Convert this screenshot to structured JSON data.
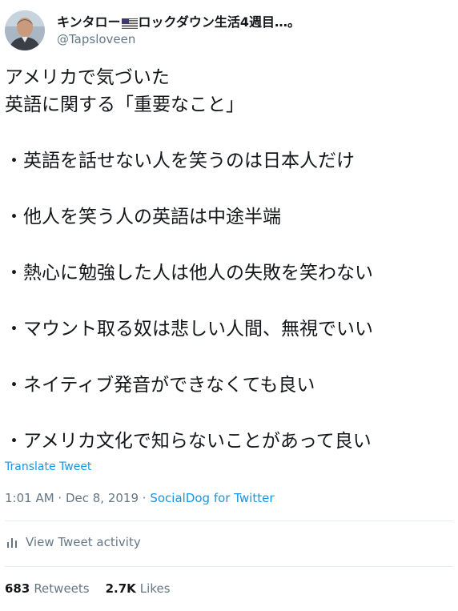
{
  "user": {
    "display_name_pre": "キンタロー",
    "display_name_post": "ロックダウン生活4週目…。",
    "handle": "@Tapsloveen",
    "flag_icon": "us-flag-icon"
  },
  "tweet": {
    "lines": [
      "アメリカで気づいた",
      "英語に関する「重要なこと」"
    ],
    "bullets": [
      "・英語を話せない人を笑うのは日本人だけ",
      "・他人を笑う人の英語は中途半端",
      "・熱心に勉強した人は他人の失敗を笑わない",
      "・マウント取る奴は悲しい人間、無視でいい",
      "・ネイティブ発音ができなくても良い",
      "・アメリカ文化で知らないことがあって良い"
    ],
    "translate_label": "Translate Tweet"
  },
  "meta": {
    "time": "1:01 AM",
    "sep1": " · ",
    "date": "Dec 8, 2019",
    "sep2": " · ",
    "source": "SocialDog for Twitter"
  },
  "activity": {
    "label": "View Tweet activity"
  },
  "stats": {
    "retweets_count": "683",
    "retweets_label": "Retweets",
    "likes_count": "2.7K",
    "likes_label": "Likes"
  },
  "colors": {
    "link": "#1b95e0",
    "muted": "#657786",
    "text": "#14171a"
  }
}
